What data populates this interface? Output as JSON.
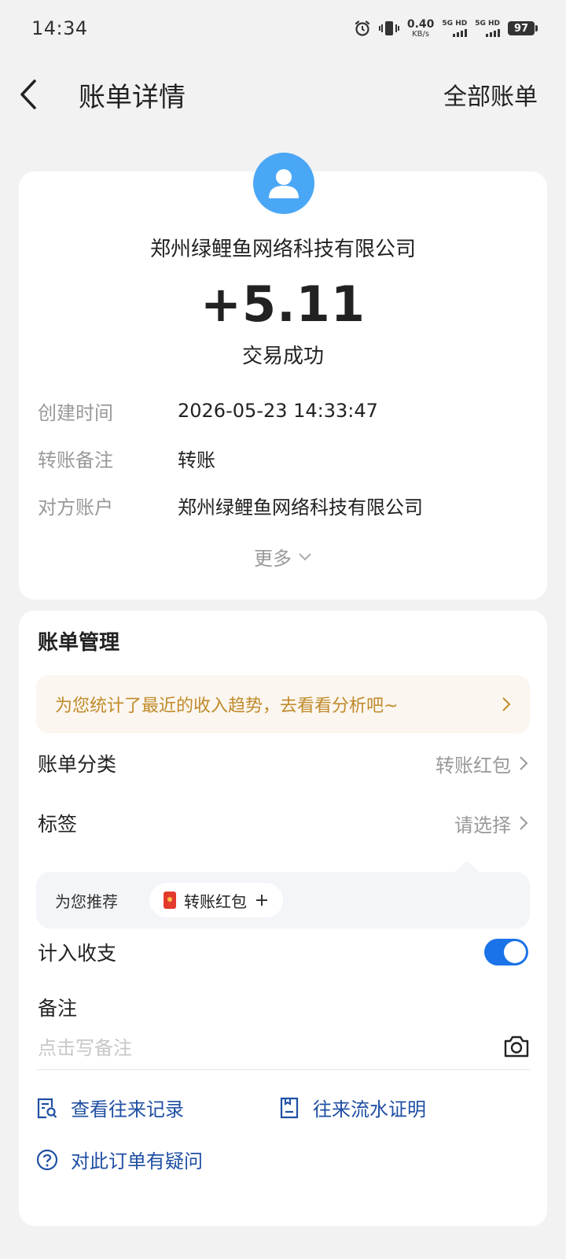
{
  "status_bar": {
    "time": "14:34",
    "net_speed": "0.40",
    "net_unit": "KB/s",
    "sim1_label": "5G HD",
    "sim2_label": "5G HD",
    "battery": "97"
  },
  "nav": {
    "title": "账单详情",
    "right_action": "全部账单"
  },
  "transaction": {
    "payee": "郑州绿鲤鱼网络科技有限公司",
    "amount": "+5.11",
    "status": "交易成功",
    "details": [
      {
        "label": "创建时间",
        "value": "2026-05-23 14:33:47"
      },
      {
        "label": "转账备注",
        "value": "转账"
      },
      {
        "label": "对方账户",
        "value": "郑州绿鲤鱼网络科技有限公司"
      }
    ],
    "more_label": "更多"
  },
  "manage": {
    "title": "账单管理",
    "analysis_banner": "为您统计了最近的收入趋势，去看看分析吧~",
    "category_label": "账单分类",
    "category_value": "转账红包",
    "tag_label": "标签",
    "tag_value": "请选择",
    "recommend_label": "为您推荐",
    "recommend_chip": "转账红包",
    "count_in_label": "计入收支",
    "count_in_enabled": true,
    "memo_label": "备注",
    "memo_placeholder": "点击写备注",
    "links": [
      {
        "label": "查看往来记录",
        "icon": "search-record-icon"
      },
      {
        "label": "往来流水证明",
        "icon": "document-icon"
      },
      {
        "label": "对此订单有疑问",
        "icon": "question-icon"
      }
    ]
  },
  "colors": {
    "accent": "#1a73e8",
    "avatar_bg": "#4aa7f5",
    "link": "#1f4fa3",
    "banner_text": "#c08a2a",
    "banner_bg": "#fbf6ef"
  }
}
